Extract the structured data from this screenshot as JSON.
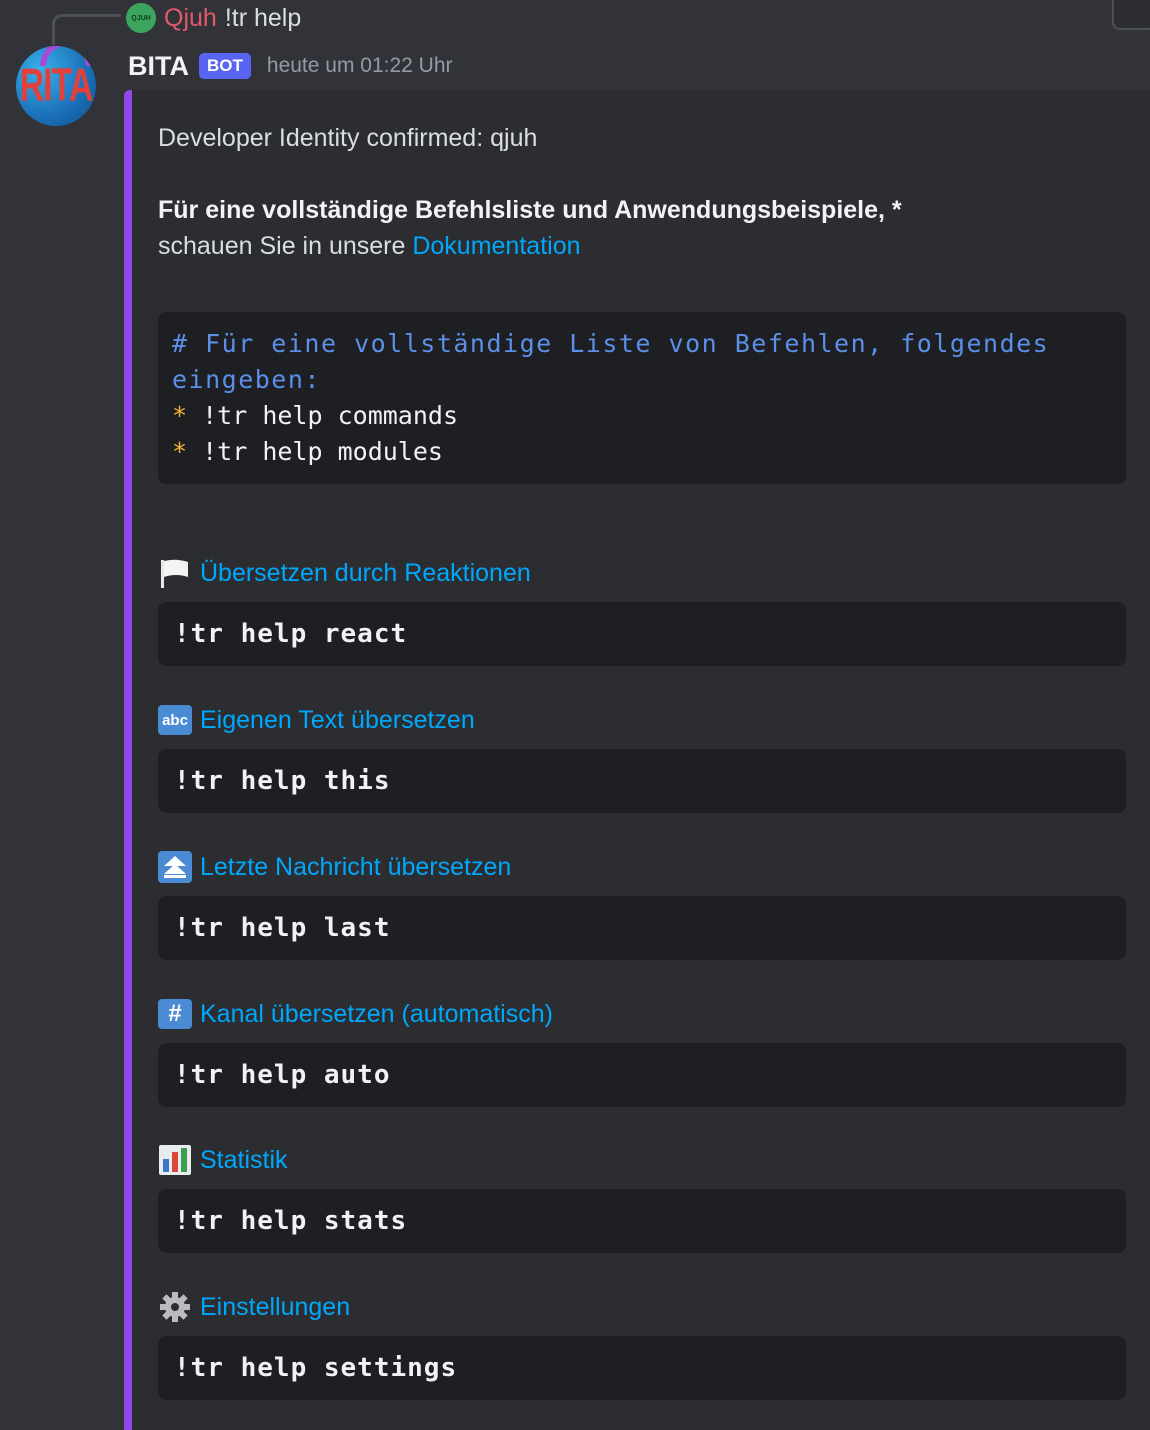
{
  "reply": {
    "avatar_text": "QJUH",
    "author": "Qjuh",
    "text": "!tr help"
  },
  "message": {
    "avatar_text": "RITA",
    "username": "BITA",
    "badge": "BOT",
    "timestamp": "heute um 01:22 Uhr"
  },
  "embed": {
    "accent_color": "#9147ea",
    "line1": "Developer Identity confirmed: qjuh",
    "line2": "Für eine vollständige Befehlsliste und Anwendungsbeispiele, *",
    "line3_prefix": "schauen Sie in unsere ",
    "line3_link": "Dokumentation",
    "code_comment": "# Für eine vollständige Liste von Befehlen, folgendes eingeben:",
    "code_bullet_1": "!tr help commands",
    "code_bullet_2": "!tr help modules",
    "bullet_star": "*",
    "sections": [
      {
        "icon": "white-flag-icon",
        "title": "Übersetzen durch Reaktionen",
        "command": "!tr help react"
      },
      {
        "icon": "abc-icon",
        "title": "Eigenen Text übersetzen",
        "command": "!tr help this"
      },
      {
        "icon": "double-up-arrow-icon",
        "title": "Letzte Nachricht übersetzen",
        "command": "!tr help last"
      },
      {
        "icon": "hash-icon",
        "title": "Kanal übersetzen (automatisch)",
        "command": "!tr help auto"
      },
      {
        "icon": "bar-chart-icon",
        "title": "Statistik",
        "command": "!tr help stats"
      },
      {
        "icon": "gear-icon",
        "title": "Einstellungen",
        "command": "!tr help settings"
      }
    ],
    "icon_labels": {
      "abc": "abc",
      "hash": "#"
    }
  },
  "colors": {
    "background": "#313338",
    "embed_background": "#2b2d31",
    "code_background": "#1e1f22",
    "link": "#00a8fc",
    "bot_badge": "#5865f2"
  }
}
